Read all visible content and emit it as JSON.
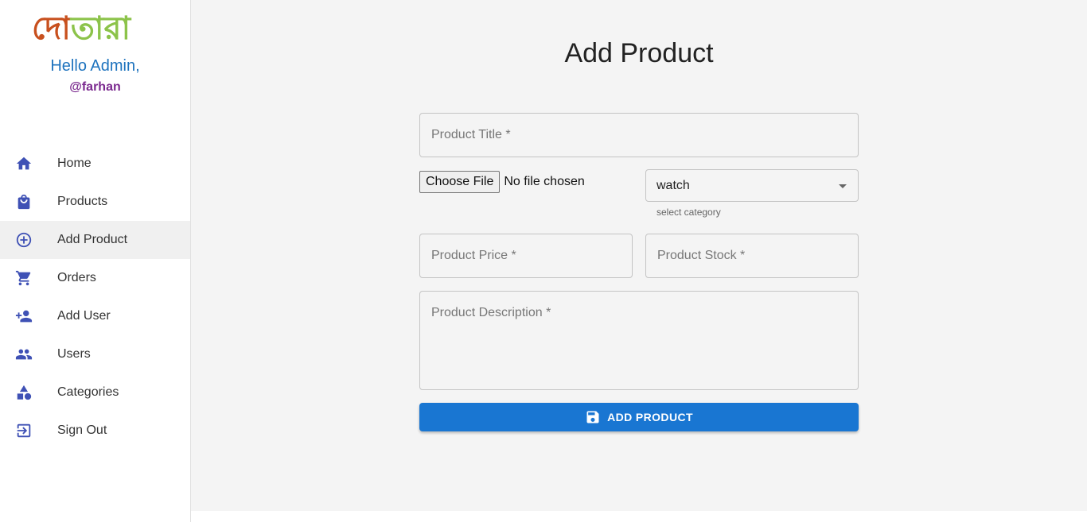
{
  "brand": {
    "logo_part1": "দো",
    "logo_part2": "তারা"
  },
  "greeting": {
    "hello": "Hello Admin,",
    "username": "@farhan"
  },
  "sidebar": {
    "items": [
      {
        "label": "Home",
        "icon": "home-icon"
      },
      {
        "label": "Products",
        "icon": "shopping-bag-icon"
      },
      {
        "label": "Add Product",
        "icon": "add-circle-icon",
        "active": true
      },
      {
        "label": "Orders",
        "icon": "cart-icon"
      },
      {
        "label": "Add User",
        "icon": "person-add-icon"
      },
      {
        "label": "Users",
        "icon": "people-icon"
      },
      {
        "label": "Categories",
        "icon": "category-icon"
      },
      {
        "label": "Sign Out",
        "icon": "sign-out-icon"
      }
    ]
  },
  "form": {
    "title": "Add Product",
    "product_title_placeholder": "Product Title *",
    "file_button": "Choose File",
    "file_status": "No file chosen",
    "category_value": "watch",
    "category_helper": "select category",
    "price_placeholder": "Product Price *",
    "stock_placeholder": "Product Stock *",
    "description_placeholder": "Product Description *",
    "submit_label": "ADD PRODUCT"
  },
  "colors": {
    "accent": "#1976d2",
    "icon": "#3f51b5",
    "brand_red": "#c8501e",
    "brand_green": "#8cc34a",
    "hello": "#1e73be",
    "username": "#7b2a8f"
  }
}
